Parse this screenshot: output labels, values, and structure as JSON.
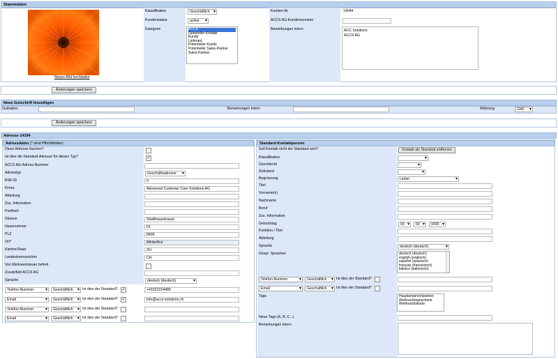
{
  "stammdaten": {
    "title": "Stammdaten",
    "upload_link": "Neues Bild hochladen",
    "klassifikation_label": "Klassifikation",
    "klassifikation_value": "Geschäftlich",
    "kundenstatus_label": "Kundenstatus",
    "kundenstatus_value": "active",
    "kategorie_label": "Kategorie",
    "kategorie_options": [
      "ACCS",
      "Genereller Kontakt",
      "Kunde",
      "Lieferant",
      "Potentieller Kunde",
      "Potentieller Sales-Partner",
      "Sales-Partner"
    ],
    "kunden_nr_label": "Kunden-Nr",
    "kunden_nr_value": "14044",
    "accs_kundennummer_label": "ACCS AG-Kundennummer",
    "bemerkungen_label": "Bemerkungen intern",
    "bemerkungen_lines": [
      "ACC Solutions",
      "ACCS AG"
    ],
    "save_button": "Änderungen speichern"
  },
  "gutschrift": {
    "title": "Neue Gutschrift hinzufügen",
    "guthaben_label": "Guthaben",
    "bemerkungen_label": "Bemerkungen intern",
    "waehrung_label": "Währung",
    "waehrung_value": "CHF",
    "save_button": "Änderungen speichern"
  },
  "adresse": {
    "title": "Adresse 14194",
    "adressdaten_title": "Adressdaten",
    "adressdaten_hint": "(* sind Pflichtfelder)",
    "fields": {
      "loeschen": "Diese Adresse löschen?",
      "standard": "Ist dies die Standard-Adresse für diesen Typ?",
      "accs_nr": "ACCS AG-Adress-Nummer",
      "adresstyp": "Adresstyp",
      "adresstyp_value": "Geschäftsadresse",
      "bsk_id": "BSK-ID",
      "bsk_id_value": "0",
      "firma": "Firma",
      "firma_value": "Advanced Customer Care Solutions AG",
      "abteilung": "Abteilung",
      "zus_info": "Zus. Information",
      "postfach": "Postfach",
      "strasse": "Strasse",
      "strasse_value": "Stadthausstrasse",
      "hausnummer": "Hausnummer",
      "hausnummer_value": "61",
      "plz": "PLZ",
      "plz_value": "8400",
      "ort": "Ort*",
      "ort_value": "Winterthur",
      "kanton": "Kanton/Staat",
      "kanton_value": "ZH",
      "landeskennzeichen": "Landeskennzeichen",
      "landeskennzeichen_value": "CH",
      "mwst": "Von Mehrwertsteuer befreit",
      "zusatzfeld": "Zusatzfeld ACCS AG",
      "sprache": "Sprache",
      "sprache_value": "deutsch (deutsch)"
    },
    "contacts": [
      {
        "type": "Telefon-Nummer",
        "class": "Geschäftlich",
        "question": "Ist dies der Standard?",
        "checked": true,
        "value": "+41522224480"
      },
      {
        "type": "Email",
        "class": "Geschäftlich",
        "question": "Ist dies der Standard?",
        "checked": true,
        "value": "info@accs-solutions.ch"
      },
      {
        "type": "Telefon-Nummer",
        "class": "Geschäftlich",
        "question": "Ist dies der Standard?",
        "checked": false,
        "value": ""
      },
      {
        "type": "Email",
        "class": "Geschäftlich",
        "question": "Ist dies der Standard?",
        "checked": false,
        "value": ""
      }
    ]
  },
  "kontaktperson": {
    "title": "Standard-Kontaktperson",
    "nicht_standard": "Soll Kontakt nicht der Standard sein?",
    "remove_button": "Kontakt als Standard entfernen",
    "klassifikation": "Klassifikation",
    "geschlecht": "Geschlecht",
    "zivilstand": "Zivilstand",
    "begruessung": "Begrüssung",
    "begruessung_value": "Lieber",
    "titel": "Titel",
    "vornamen": "Vorname(n)",
    "nachname": "Nachname",
    "beruf": "Beruf",
    "zus_info": "Zus. Information",
    "geburtstag": "Geburtstag",
    "geburtstag_day": "00",
    "geburtstag_month": "00",
    "geburtstag_year": "0000",
    "funktion": "Funktion / Titel",
    "abteilung": "Abteilung",
    "sprache": "Sprache",
    "sprache_value": "deutsch (deutsch)",
    "gespr_sprachen": "Gespr. Sprachen",
    "sprachen_options": [
      "deutsch (deutsch)",
      "english (englisch)",
      "español (spanisch)",
      "français (französisch)",
      "italiano (italienisch)"
    ],
    "contacts": [
      {
        "type": "Telefon-Nummer",
        "class": "Geschäftlich",
        "question": "Ist dies der Standard?"
      },
      {
        "type": "Email",
        "class": "Geschäftlich",
        "question": "Ist dies der Standard?"
      }
    ],
    "tags": "Tags",
    "tags_options": [
      "Hauptansprechpartner",
      "Weihnachtsgeschenk",
      "Weihnachtskarte"
    ],
    "neue_tags": "Neue Tags (A, B, C...)",
    "bemerkungen": "Bemerkungen intern"
  },
  "colors": {
    "header": "#b8d0ee",
    "label_bg": "#dce7f7",
    "accent": "#3875d7"
  }
}
